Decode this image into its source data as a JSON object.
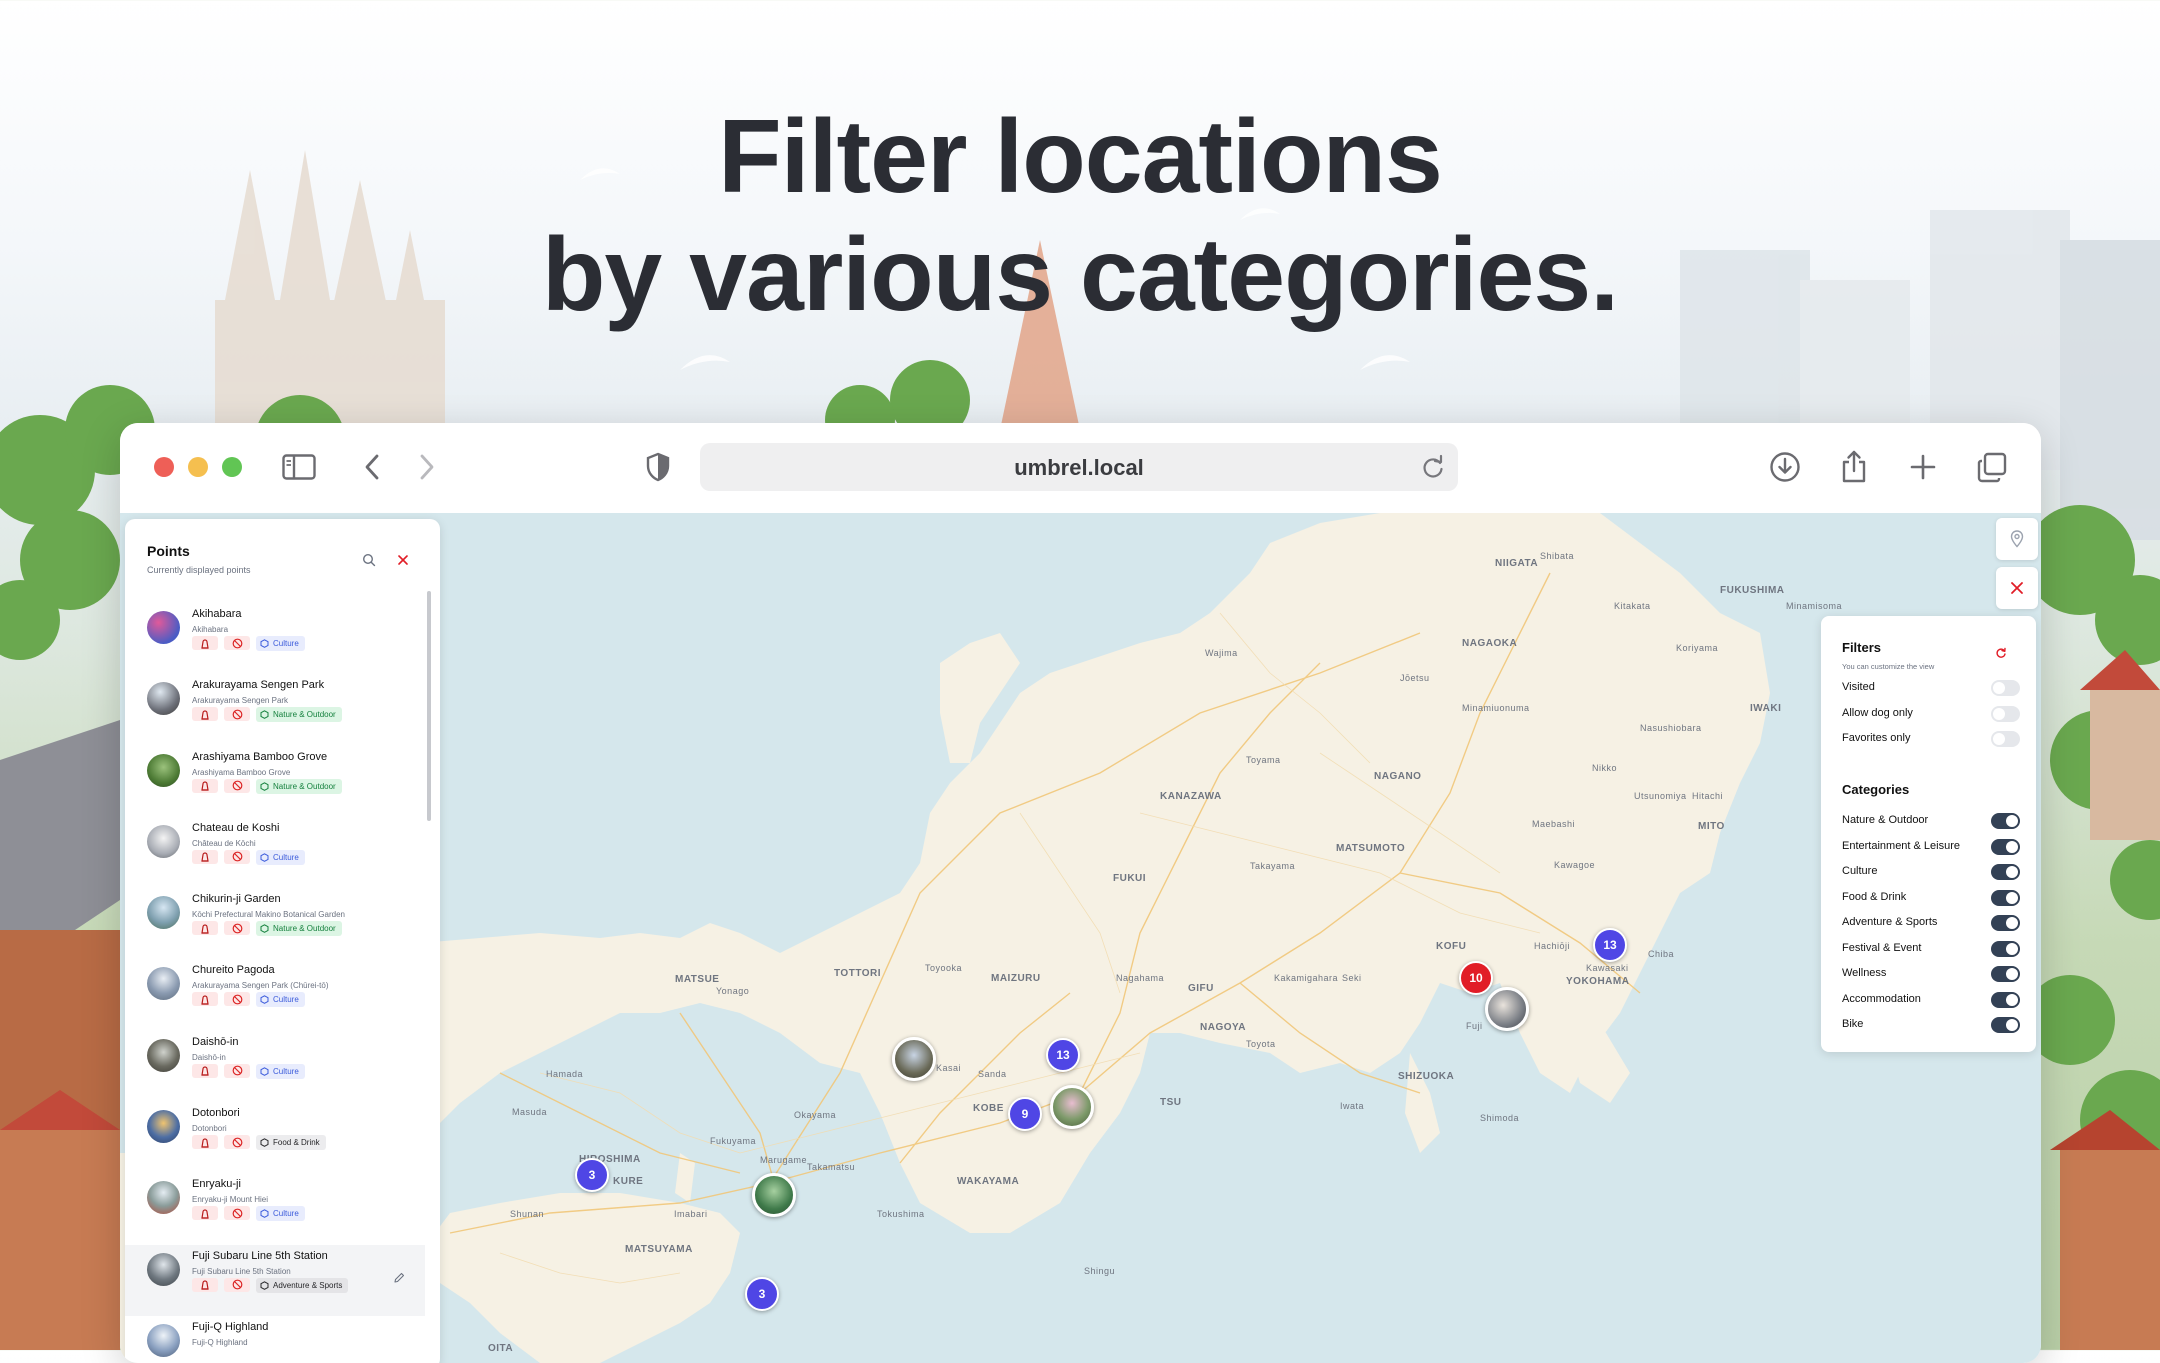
{
  "headline": {
    "line1": "Filter locations",
    "line2": "by various categories."
  },
  "browser": {
    "url": "umbrel.local"
  },
  "points_panel": {
    "title": "Points",
    "subtitle": "Currently displayed points",
    "items": [
      {
        "name": "Akihabara",
        "address": "Akihabara",
        "category": "Culture",
        "cat_class": "culture",
        "thumb": "#6d5aa8"
      },
      {
        "name": "Arakurayama Sengen Park",
        "address": "Arakurayama Sengen Park",
        "category": "Nature & Outdoor",
        "cat_class": "nature",
        "thumb": "#7b8a9c"
      },
      {
        "name": "Arashiyama Bamboo Grove",
        "address": "Arashiyama Bamboo Grove",
        "category": "Nature & Outdoor",
        "cat_class": "nature",
        "thumb": "#4f7a3a"
      },
      {
        "name": "Chateau de Koshi",
        "address": "Château de Kōchi",
        "category": "Culture",
        "cat_class": "culture",
        "thumb": "#b8bcc4"
      },
      {
        "name": "Chikurin-ji Garden",
        "address": "Kōchi Prefectural Makino Botanical Garden",
        "category": "Nature & Outdoor",
        "cat_class": "nature",
        "thumb": "#8ea7b5"
      },
      {
        "name": "Chureito Pagoda",
        "address": "Arakurayama Sengen Park (Chūrei-tō)",
        "category": "Culture",
        "cat_class": "culture",
        "thumb": "#8d9db4"
      },
      {
        "name": "Daishō-in",
        "address": "Daishō-in",
        "category": "Culture",
        "cat_class": "culture",
        "thumb": "#6b6a64"
      },
      {
        "name": "Dotonbori",
        "address": "Dotonbori",
        "category": "Food & Drink",
        "cat_class": "food",
        "thumb": "#4f6fa0"
      },
      {
        "name": "Enryaku-ji",
        "address": "Enryaku-ji Mount Hiei",
        "category": "Culture",
        "cat_class": "culture",
        "thumb": "#7c8c8c"
      },
      {
        "name": "Fuji Subaru Line 5th Station",
        "address": "Fuji Subaru Line 5th Station",
        "category": "Adventure & Sports",
        "cat_class": "adv",
        "thumb": "#57636f"
      },
      {
        "name": "Fuji-Q Highland",
        "address": "Fuji-Q Highland",
        "category": "Culture",
        "cat_class": "culture",
        "thumb": "#8aa0c0"
      }
    ]
  },
  "filters_panel": {
    "title": "Filters",
    "subtitle": "You can customize the view",
    "toggles": [
      {
        "label": "Visited",
        "on": false
      },
      {
        "label": "Allow dog only",
        "on": false
      },
      {
        "label": "Favorites only",
        "on": false
      }
    ],
    "categories_title": "Categories",
    "categories": [
      {
        "label": "Nature & Outdoor",
        "on": true
      },
      {
        "label": "Entertainment & Leisure",
        "on": true
      },
      {
        "label": "Culture",
        "on": true
      },
      {
        "label": "Food & Drink",
        "on": true
      },
      {
        "label": "Adventure & Sports",
        "on": true
      },
      {
        "label": "Festival & Event",
        "on": true
      },
      {
        "label": "Wellness",
        "on": true
      },
      {
        "label": "Accommodation",
        "on": true
      },
      {
        "label": "Bike",
        "on": true
      }
    ]
  },
  "map": {
    "places": [
      {
        "name": "NIIGATA",
        "size": "small"
      },
      {
        "name": "Shibata",
        "size": "small"
      },
      {
        "name": "FUKUSHIMA",
        "size": "small"
      },
      {
        "name": "Kitakata",
        "size": "small"
      },
      {
        "name": "Minamisoma",
        "size": "small"
      },
      {
        "name": "NAGAOKA",
        "size": "small"
      },
      {
        "name": "Koriyama",
        "size": "small"
      },
      {
        "name": "Wajima",
        "size": "small"
      },
      {
        "name": "Jōetsu",
        "size": "small"
      },
      {
        "name": "IWAKI",
        "size": "small"
      },
      {
        "name": "Minamiuonuma",
        "size": "small"
      },
      {
        "name": "Nasushiobara",
        "size": "small"
      },
      {
        "name": "Toyama",
        "size": "small"
      },
      {
        "name": "NAGANO",
        "size": "small"
      },
      {
        "name": "KANAZAWA",
        "size": "small"
      },
      {
        "name": "Nikko",
        "size": "small"
      },
      {
        "name": "Utsunomiya",
        "size": "small"
      },
      {
        "name": "Hitachi",
        "size": "small"
      },
      {
        "name": "Maebashi",
        "size": "small"
      },
      {
        "name": "MITO",
        "size": "small"
      },
      {
        "name": "MATSUMOTO",
        "size": "small"
      },
      {
        "name": "FUKUI",
        "size": "small"
      },
      {
        "name": "Takayama",
        "size": "small"
      },
      {
        "name": "Kawagoe",
        "size": "small"
      },
      {
        "name": "KOFU",
        "size": "small"
      },
      {
        "name": "Hachiōji",
        "size": "small"
      },
      {
        "name": "Chiba",
        "size": "small"
      },
      {
        "name": "MATSUE",
        "size": "small"
      },
      {
        "name": "TOTTORI",
        "size": "small"
      },
      {
        "name": "Toyooka",
        "size": "small"
      },
      {
        "name": "MAIZURU",
        "size": "small"
      },
      {
        "name": "Nagahama",
        "size": "small"
      },
      {
        "name": "GIFU",
        "size": "small"
      },
      {
        "name": "Kakamigahara",
        "size": "small"
      },
      {
        "name": "Seki",
        "size": "small"
      },
      {
        "name": "Kawasaki",
        "size": "small"
      },
      {
        "name": "YOKOHAMA",
        "size": "small"
      },
      {
        "name": "Yonago",
        "size": "small"
      },
      {
        "name": "Fuji",
        "size": "small"
      },
      {
        "name": "NAGOYA",
        "size": "small"
      },
      {
        "name": "Toyota",
        "size": "small"
      },
      {
        "name": "Hamada",
        "size": "small"
      },
      {
        "name": "Kasai",
        "size": "small"
      },
      {
        "name": "Sanda",
        "size": "small"
      },
      {
        "name": "SHIZUOKA",
        "size": "small"
      },
      {
        "name": "Masuda",
        "size": "small"
      },
      {
        "name": "Okayama",
        "size": "small"
      },
      {
        "name": "KOBE",
        "size": "small"
      },
      {
        "name": "TSU",
        "size": "small"
      },
      {
        "name": "Shimoda",
        "size": "small"
      },
      {
        "name": "Iwata",
        "size": "small"
      },
      {
        "name": "Fukuyama",
        "size": "small"
      },
      {
        "name": "Marugame",
        "size": "small"
      },
      {
        "name": "HIROSHIMA",
        "size": "small"
      },
      {
        "name": "Takamatsu",
        "size": "small"
      },
      {
        "name": "KURE",
        "size": "small"
      },
      {
        "name": "WAKAYAMA",
        "size": "small"
      },
      {
        "name": "Tokushima",
        "size": "small"
      },
      {
        "name": "Shunan",
        "size": "small"
      },
      {
        "name": "Imabari",
        "size": "small"
      },
      {
        "name": "MATSUYAMA",
        "size": "small"
      },
      {
        "name": "Shingu",
        "size": "small"
      },
      {
        "name": "OITA",
        "size": "small"
      }
    ],
    "clusters": [
      {
        "count": "13",
        "color": "indigo"
      },
      {
        "count": "10",
        "color": "red"
      },
      {
        "count": "13",
        "color": "indigo"
      },
      {
        "count": "9",
        "color": "indigo"
      },
      {
        "count": "3",
        "color": "indigo"
      },
      {
        "count": "3",
        "color": "indigo"
      }
    ]
  },
  "colors": {
    "accent": "#4f46e5",
    "cluster_red": "#e11d27",
    "toggle_on": "#334155",
    "close_red": "#e11d27"
  }
}
